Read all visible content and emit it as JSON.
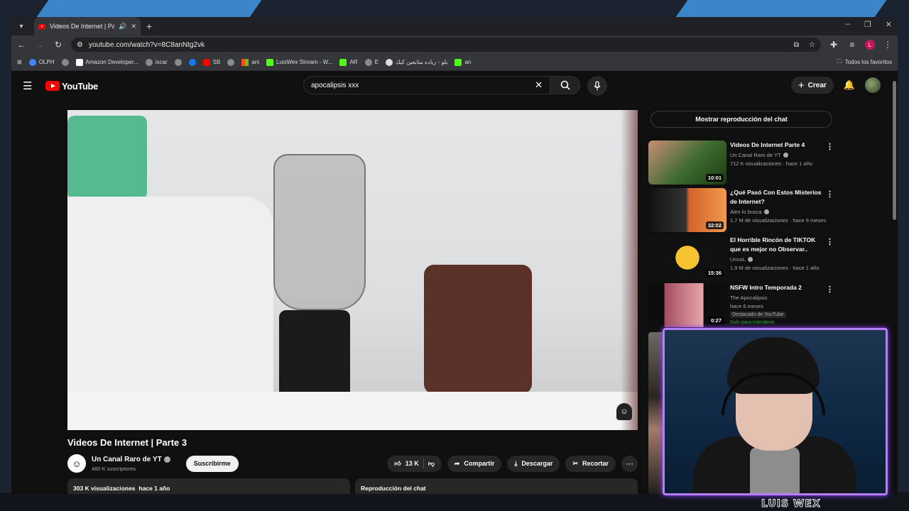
{
  "browser": {
    "tab_title": "Videos De Internet | Parte 3",
    "url": "youtube.com/watch?v=8C8anNtg2vk",
    "profile_initial": "L",
    "bookmarks": [
      "OLPH",
      "",
      "Amazon Developer...",
      "iscar",
      "",
      "",
      "SB",
      "",
      "ani",
      "LuisWex Stream - W...",
      "AR",
      "E",
      "بلو - زياده متابعين كيك",
      "an"
    ],
    "bookmarks_folder": "Todos los favoritos"
  },
  "youtube": {
    "logo_text": "YouTube",
    "search_value": "apocalipsis xxx",
    "create_label": "Crear",
    "video": {
      "title": "Videos De Internet | Parte 3",
      "channel": "Un Canal Raro de YT",
      "subscribers": "460 K suscriptores",
      "subscribe_label": "Suscribirme",
      "likes": "13 K",
      "share_label": "Compartir",
      "download_label": "Descargar",
      "clip_label": "Recortar",
      "views": "303 K visualizaciones",
      "age": "hace 1 año",
      "chat_replay_label": "Reproducción del chat"
    },
    "sidebar": {
      "show_chat_label": "Mostrar reproducción del chat",
      "recommendations": [
        {
          "title": "Videos De Internet Parte 4",
          "channel": "Un Canal Raro de YT",
          "stats": "712 K visualizaciones · hace 1 año",
          "duration": "10:01",
          "verified": true
        },
        {
          "title": "¿Qué Pasó Con Estos Misterios de Internet?",
          "channel": "Alex lo busca",
          "stats": "1,7 M de visualizaciones · hace 9 meses",
          "duration": "32:02",
          "verified": true
        },
        {
          "title": "El Horrible Rincón de TIKTOK que es mejor no Observar..",
          "channel": "UnnoL",
          "stats": "1,9 M de visualizaciones · hace 1 año",
          "duration": "15:36",
          "verified": true
        },
        {
          "title": "NSFW Intro Temporada 2",
          "channel": "The Apocalipsis",
          "stats": "hace 6 meses",
          "duration": "0:27",
          "badge": "Destacado de YouTube",
          "members": "Solo para miembros"
        }
      ]
    }
  },
  "overlay": {
    "streamer_name": "LUIS WEX",
    "accent_color": "#b57dff"
  }
}
